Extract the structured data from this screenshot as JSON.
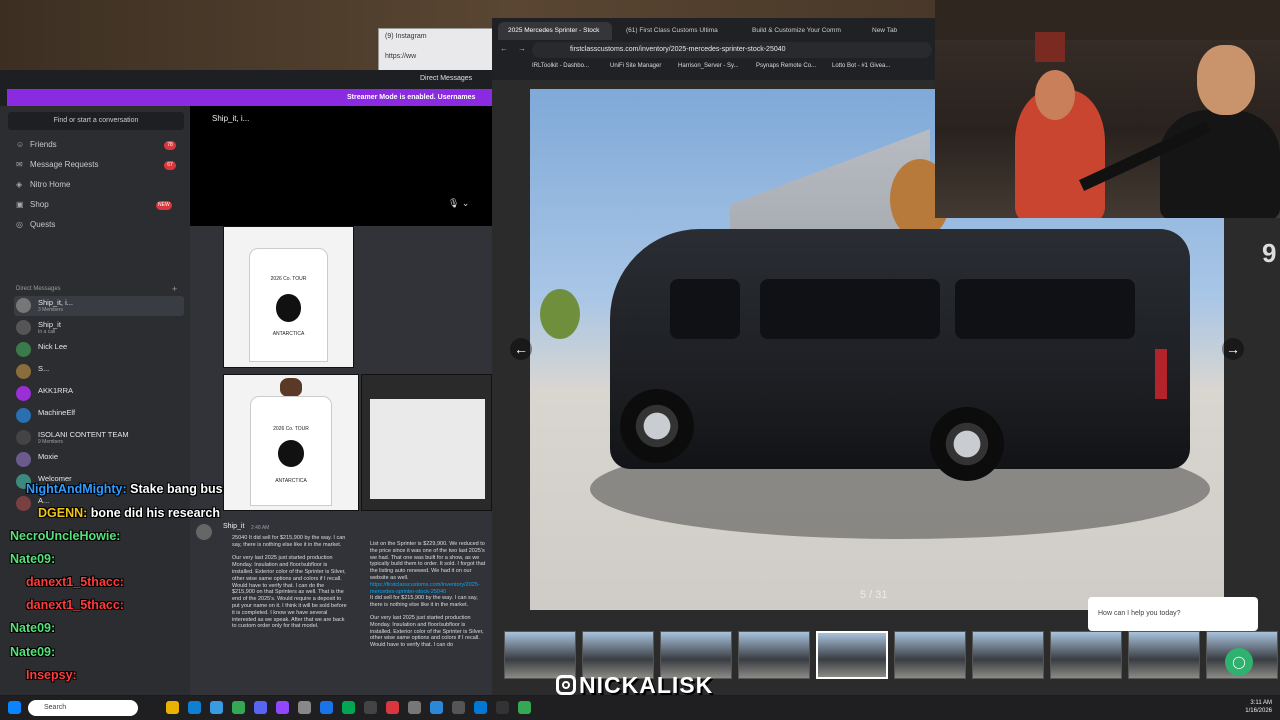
{
  "instagram_window": {
    "tab": "(9) Instagram",
    "url": "https://ww"
  },
  "discord": {
    "title": "Direct Messages",
    "streamer_banner": "Streamer Mode is enabled. Usernames have bee",
    "search": "Find or start a conversation",
    "nav": [
      {
        "label": "Friends",
        "badge": "78"
      },
      {
        "label": "Message Requests",
        "badge": "67"
      },
      {
        "label": "Nitro Home",
        "badge": ""
      },
      {
        "label": "Shop",
        "badge": "NEW"
      },
      {
        "label": "Quests",
        "badge": ""
      }
    ],
    "dm_header": "Direct Messages",
    "dms": [
      {
        "name": "Ship_it, i...",
        "sub": "3 Members"
      },
      {
        "name": "Ship_it",
        "sub": "In a call"
      },
      {
        "name": "Nick Lee",
        "sub": ""
      },
      {
        "name": "S...",
        "sub": ""
      },
      {
        "name": "AKK1RRA",
        "sub": ""
      },
      {
        "name": "MachineElf",
        "sub": ""
      },
      {
        "name": "ISOLANI CONTENT TEAM",
        "sub": "9 Members"
      },
      {
        "name": "Moxie",
        "sub": ""
      },
      {
        "name": "Welcomer",
        "sub": ""
      },
      {
        "name": "A...",
        "sub": ""
      }
    ],
    "call_name": "Ship_it, i...",
    "shirt_tour_text": "2026 Co. TOUR",
    "shirt_label": "ANTARCTICA",
    "msg_author": "Ship_it",
    "msg_time": "2:48 AM",
    "msg_left": "25040 It did sell for $215,900 by the way. I can say, there is nothing else like it in the market.\n\nOur very last 2025 just started production Monday. Insulation and floor/subfloor is installed. Exterior color of the Sprinter is Silver, other wise same options and colors if I recall. Would have to verify that. I can do the $215,900 on that Sprinters as well. That is the end of the 2025's. Would require a deposit to put your name on it. I think it will be sold before it is completed. I know we have several interested as we speak. After that we are back to custom order only for that model.",
    "msg_right_1": "List on the Sprinter is $229,900. We reduced to the price since it was one of the two last 2025's we had. That one was built for a show, as we typically build them to order. It sold. I forgot that the listing auto renewed. We had it on our website as well.",
    "msg_right_link": "https://firstclasscustoms.com/inventory/2025-mercedes-sprinter-stock-25040",
    "msg_right_2": "It did sell for $215,900 by the way. I can say, there is nothing else like it in the market.",
    "msg_right_3": "Our very last 2025 just started production Monday. Insulation and floor/subfloor is installed. Exterior color of the Sprinter is Silver, other wise same options and colors if I recall. Would have to verify that. I can do"
  },
  "browser": {
    "tabs": [
      "2025 Mercedes Sprinter - Stock",
      "(61) First Class Customs Ultima",
      "Build & Customize Your Comm",
      "New Tab"
    ],
    "url": "firstclasscustoms.com/inventory/2025-mercedes-sprinter-stock-25040",
    "bookmarks": [
      "IRLToolkit - Dashbo...",
      "UniFi Site Manager",
      "Harrison_Server - Sy...",
      "Psynaps Remote Co...",
      "Lotto Bot - #1 Givea..."
    ]
  },
  "gallery": {
    "counter": "5 / 31",
    "chat_prompt": "How can I help you today?",
    "selected_thumb": 4,
    "thumb_count": 10
  },
  "side_digit": "9",
  "overlay_chat": [
    {
      "name": "NightAndMighty:",
      "msg": "Stake bang bus",
      "color": "#2f9cff"
    },
    {
      "name": "DGENN:",
      "msg": "bone did his research",
      "color": "#f0c419"
    },
    {
      "name": "NecroUncleHowie:",
      "msg": "",
      "color": "#55e27a"
    },
    {
      "name": "Nate09:",
      "msg": "",
      "color": "#55e27a"
    },
    {
      "name": "danext1_5thacc:",
      "msg": "",
      "color": "#ff3b3b"
    },
    {
      "name": "danext1_5thacc:",
      "msg": "",
      "color": "#ff3b3b"
    },
    {
      "name": "Nate09:",
      "msg": "",
      "color": "#55e27a"
    },
    {
      "name": "Nate09:",
      "msg": "",
      "color": "#55e27a"
    },
    {
      "name": "Insepsy:",
      "msg": "",
      "color": "#ff3b3b"
    }
  ],
  "watermark": "NICKALISK",
  "taskbar": {
    "search": "Search",
    "time": "3:11 AM",
    "date": "1/16/2026"
  }
}
